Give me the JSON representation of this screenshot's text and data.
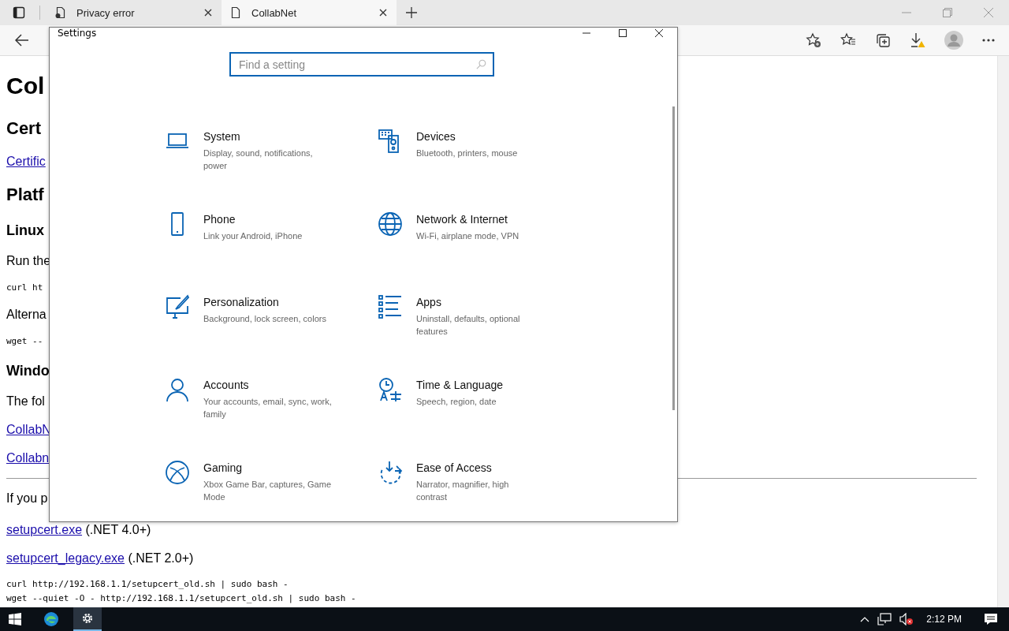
{
  "browser": {
    "tabs": [
      {
        "title": "Privacy error",
        "selected": false
      },
      {
        "title": "CollabNet",
        "selected": true
      }
    ]
  },
  "page": [
    {
      "kind": "h1",
      "text": "Col"
    },
    {
      "kind": "h2",
      "text": "Cert"
    },
    {
      "kind": "link",
      "text": "Certific"
    },
    {
      "kind": "h2",
      "text": "Platf"
    },
    {
      "kind": "h3",
      "text": "Linux"
    },
    {
      "kind": "p",
      "text": "Run the"
    },
    {
      "kind": "code",
      "text": "curl ht"
    },
    {
      "kind": "p",
      "text": "Alterna"
    },
    {
      "kind": "code",
      "text": "wget --"
    },
    {
      "kind": "h3",
      "text": "Windo"
    },
    {
      "kind": "p",
      "text": "The fol"
    },
    {
      "kind": "link",
      "text": "CollabN"
    },
    {
      "kind": "link",
      "text": "Collabn"
    },
    {
      "kind": "rule"
    },
    {
      "kind": "p",
      "text": "If you p"
    },
    {
      "kind": "linkline",
      "link": "setupcert.exe",
      "text": " (.NET 4.0+)"
    },
    {
      "kind": "linkline",
      "link": "setupcert_legacy.exe",
      "text": " (.NET 2.0+)"
    },
    {
      "kind": "codeblock",
      "lines": [
        "curl http://192.168.1.1/setupcert_old.sh | sudo bash -",
        "wget --quiet -O - http://192.168.1.1/setupcert_old.sh | sudo bash -"
      ]
    }
  ],
  "settings": {
    "title": "Settings",
    "search": {
      "placeholder": "Find a setting"
    },
    "categories": [
      {
        "title": "System",
        "description": "Display, sound, notifications, power"
      },
      {
        "title": "Devices",
        "description": "Bluetooth, printers, mouse"
      },
      {
        "title": "Phone",
        "description": "Link your Android, iPhone"
      },
      {
        "title": "Network & Internet",
        "description": "Wi-Fi, airplane mode, VPN"
      },
      {
        "title": "Personalization",
        "description": "Background, lock screen, colors"
      },
      {
        "title": "Apps",
        "description": "Uninstall, defaults, optional features"
      },
      {
        "title": "Accounts",
        "description": "Your accounts, email, sync, work, family"
      },
      {
        "title": "Time & Language",
        "description": "Speech, region, date"
      },
      {
        "title": "Gaming",
        "description": "Xbox Game Bar, captures, Game Mode"
      },
      {
        "title": "Ease of Access",
        "description": "Narrator, magnifier, high contrast"
      }
    ]
  },
  "taskbar": {
    "apps": [
      {
        "selected": false
      },
      {
        "selected": true
      }
    ],
    "time": "2:12 PM"
  }
}
